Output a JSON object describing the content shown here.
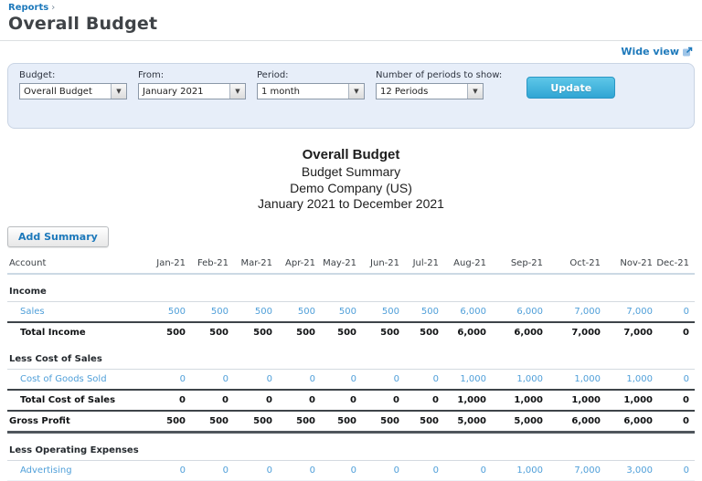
{
  "header": {
    "breadcrumb": "Reports",
    "breadcrumb_separator": "›",
    "title": "Overall Budget",
    "wide_view_label": "Wide view"
  },
  "filters": {
    "budget": {
      "label": "Budget:",
      "value": "Overall Budget"
    },
    "from": {
      "label": "From:",
      "value": "January 2021"
    },
    "period": {
      "label": "Period:",
      "value": "1 month"
    },
    "periods_to_show": {
      "label": "Number of periods to show:",
      "value": "12 Periods"
    },
    "update_label": "Update"
  },
  "report": {
    "title": "Overall Budget",
    "subtitle": "Budget Summary",
    "company": "Demo Company (US)",
    "date_range": "January 2021 to December 2021",
    "add_summary_label": "Add Summary"
  },
  "table": {
    "columns": [
      "Account",
      "Jan-21",
      "Feb-21",
      "Mar-21",
      "Apr-21",
      "May-21",
      "Jun-21",
      "Jul-21",
      "Aug-21",
      "Sep-21",
      "Oct-21",
      "Nov-21",
      "Dec-21"
    ],
    "rows": [
      {
        "type": "section",
        "label": "Income"
      },
      {
        "type": "account",
        "label": "Sales",
        "values": [
          "500",
          "500",
          "500",
          "500",
          "500",
          "500",
          "500",
          "6,000",
          "6,000",
          "7,000",
          "7,000",
          "0"
        ]
      },
      {
        "type": "total",
        "label": "Total Income",
        "values": [
          "500",
          "500",
          "500",
          "500",
          "500",
          "500",
          "500",
          "6,000",
          "6,000",
          "7,000",
          "7,000",
          "0"
        ]
      },
      {
        "type": "section",
        "label": "Less Cost of Sales"
      },
      {
        "type": "account",
        "label": "Cost of Goods Sold",
        "values": [
          "0",
          "0",
          "0",
          "0",
          "0",
          "0",
          "0",
          "1,000",
          "1,000",
          "1,000",
          "1,000",
          "0"
        ]
      },
      {
        "type": "total",
        "label": "Total Cost of Sales",
        "values": [
          "0",
          "0",
          "0",
          "0",
          "0",
          "0",
          "0",
          "1,000",
          "1,000",
          "1,000",
          "1,000",
          "0"
        ]
      },
      {
        "type": "grand",
        "label": "Gross Profit",
        "values": [
          "500",
          "500",
          "500",
          "500",
          "500",
          "500",
          "500",
          "5,000",
          "5,000",
          "6,000",
          "6,000",
          "0"
        ]
      },
      {
        "type": "section",
        "label": "Less Operating Expenses"
      },
      {
        "type": "account",
        "label": "Advertising",
        "values": [
          "0",
          "0",
          "0",
          "0",
          "0",
          "0",
          "0",
          "0",
          "1,000",
          "7,000",
          "3,000",
          "0"
        ]
      }
    ]
  },
  "colors": {
    "brand_blue": "#1d79bb",
    "table_link_blue": "#4f9fd9",
    "panel_background": "#e7eef9",
    "update_button": "#3bacd8"
  }
}
